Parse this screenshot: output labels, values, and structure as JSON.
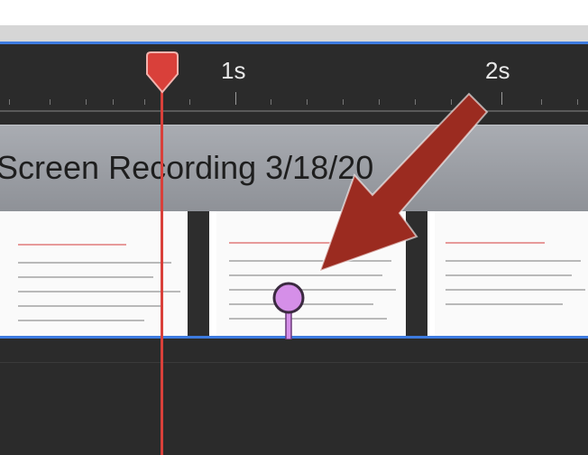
{
  "colors": {
    "playhead": "#d9403a",
    "selection_border": "#3d7be0",
    "marker": "#d58fe8",
    "arrow": "#9b2b20"
  },
  "ruler": {
    "labels": [
      "1s",
      "2s"
    ]
  },
  "clip": {
    "title": "Screen Recording 3/18/20"
  },
  "icons": {
    "playhead": "playhead-icon",
    "marker": "marker-pin-icon",
    "arrow": "annotation-arrow"
  }
}
